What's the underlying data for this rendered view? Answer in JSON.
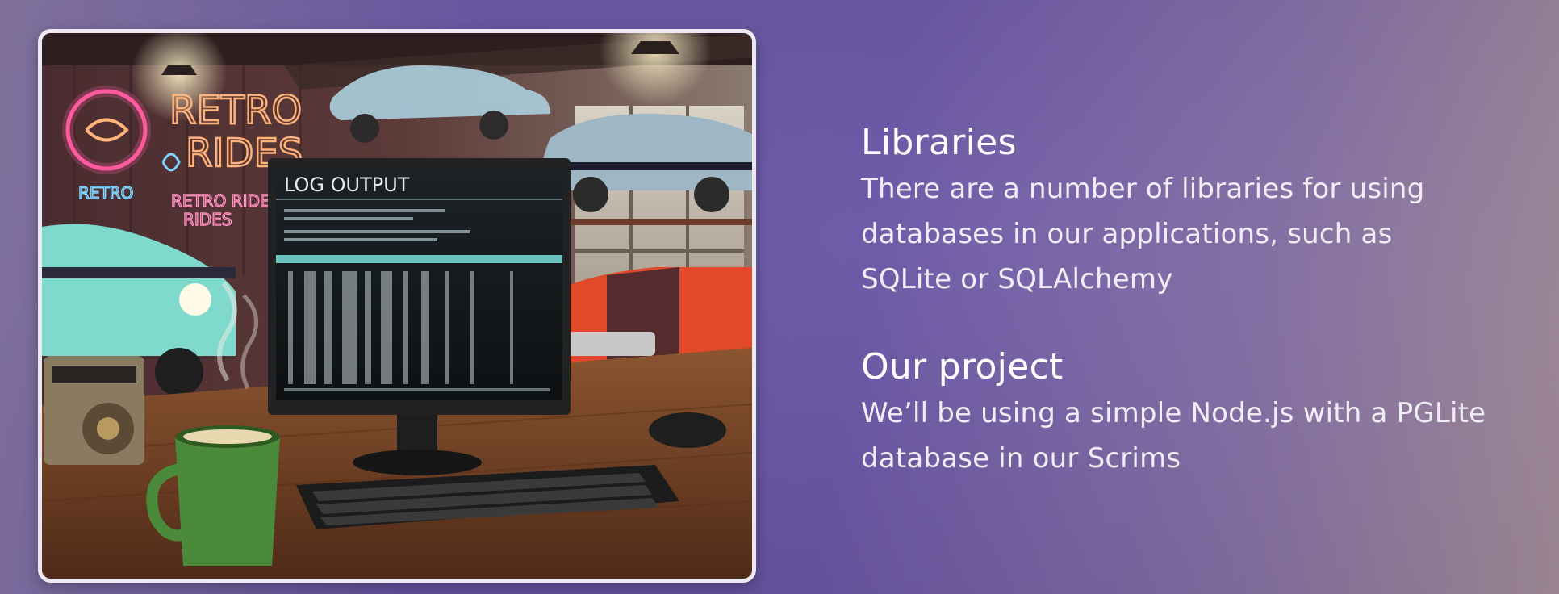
{
  "slide": {
    "illustration": {
      "neon_sign_lines": [
        "RETRO",
        "RIDES"
      ],
      "neon_small_label": "RETRO",
      "neon_sign_secondary": [
        "RETRO RIDE",
        "RIDES"
      ],
      "monitor_title": "LOG OUTPUT",
      "colors": {
        "neon_pink": "#ff5aa0",
        "neon_orange": "#ffb37a",
        "neon_blue": "#7fd4ff",
        "terminal_cyan": "#7ff0e8",
        "mug_green": "#4b8a3a",
        "desk_wood": "#7a4a2a"
      }
    },
    "sections": [
      {
        "heading": "Libraries",
        "lines": [
          "There are a number of libraries for using",
          "databases in our applications, such as",
          "SQLite or SQLAlchemy"
        ]
      },
      {
        "heading": "Our project",
        "lines": [
          "We’ll be using a simple Node.js with a PGLite",
          "database in our Scrims"
        ]
      }
    ]
  }
}
